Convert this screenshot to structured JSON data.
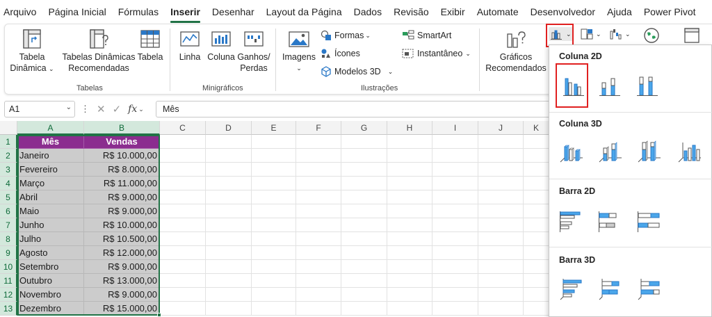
{
  "menu": {
    "tabs": [
      "Arquivo",
      "Página Inicial",
      "Fórmulas",
      "Inserir",
      "Desenhar",
      "Layout da Página",
      "Dados",
      "Revisão",
      "Exibir",
      "Automate",
      "Desenvolvedor",
      "Ajuda",
      "Power Pivot"
    ],
    "active": "Inserir"
  },
  "ribbon": {
    "tabelas": {
      "tabela_dinamica_l1": "Tabela",
      "tabela_dinamica_l2": "Dinâmica",
      "tabelas_recomendadas_l1": "Tabelas Dinâmicas",
      "tabelas_recomendadas_l2": "Recomendadas",
      "tabela": "Tabela",
      "group": "Tabelas"
    },
    "minigraficos": {
      "linha": "Linha",
      "coluna": "Coluna",
      "ganhos_l1": "Ganhos/",
      "ganhos_l2": "Perdas",
      "group": "Minigráficos"
    },
    "ilustracoes": {
      "imagens": "Imagens",
      "formas": "Formas",
      "icones": "Ícones",
      "modelos3d": "Modelos 3D",
      "smartart": "SmartArt",
      "instantaneo": "Instantâneo",
      "group": "Ilustrações"
    },
    "graficos": {
      "recomendados_l1": "Gráficos",
      "recomendados_l2": "Recomendados"
    }
  },
  "formula_bar": {
    "name_box": "A1",
    "fx": "fx",
    "content": "Mês"
  },
  "columns": [
    "A",
    "B",
    "C",
    "D",
    "E",
    "F",
    "G",
    "H",
    "I",
    "J",
    "K"
  ],
  "table": {
    "headers": [
      "Mês",
      "Vendas"
    ],
    "rows": [
      [
        "Janeiro",
        "R$ 10.000,00"
      ],
      [
        "Fevereiro",
        "R$ 8.000,00"
      ],
      [
        "Março",
        "R$ 11.000,00"
      ],
      [
        "Abril",
        "R$ 9.000,00"
      ],
      [
        "Maio",
        "R$ 9.000,00"
      ],
      [
        "Junho",
        "R$ 10.000,00"
      ],
      [
        "Julho",
        "R$ 10.500,00"
      ],
      [
        "Agosto",
        "R$ 12.000,00"
      ],
      [
        "Setembro",
        "R$ 9.000,00"
      ],
      [
        "Outubro",
        "R$ 13.000,00"
      ],
      [
        "Novembro",
        "R$ 9.000,00"
      ],
      [
        "Dezembro",
        "R$ 15.000,00"
      ]
    ]
  },
  "row_numbers": [
    "1",
    "2",
    "3",
    "4",
    "5",
    "6",
    "7",
    "8",
    "9",
    "10",
    "11",
    "12",
    "13"
  ],
  "dropdown": {
    "sections": [
      {
        "title": "Coluna 2D",
        "icons": [
          "clustered-column-icon",
          "stacked-column-icon",
          "100-stacked-column-icon"
        ]
      },
      {
        "title": "Coluna 3D",
        "icons": [
          "3d-clustered-column-icon",
          "3d-stacked-column-icon",
          "3d-100-stacked-column-icon",
          "3d-column-icon"
        ]
      },
      {
        "title": "Barra 2D",
        "icons": [
          "clustered-bar-icon",
          "stacked-bar-icon",
          "100-stacked-bar-icon"
        ]
      },
      {
        "title": "Barra 3D",
        "icons": [
          "3d-clustered-bar-icon",
          "3d-stacked-bar-icon",
          "3d-100-stacked-bar-icon"
        ]
      }
    ],
    "selected": "clustered-column-icon"
  },
  "colors": {
    "header_fill": "#8b2d8f",
    "data_fill": "#cccccc",
    "selection": "#217346",
    "highlight": "#e02020",
    "chart_blue": "#4aa6ea"
  }
}
